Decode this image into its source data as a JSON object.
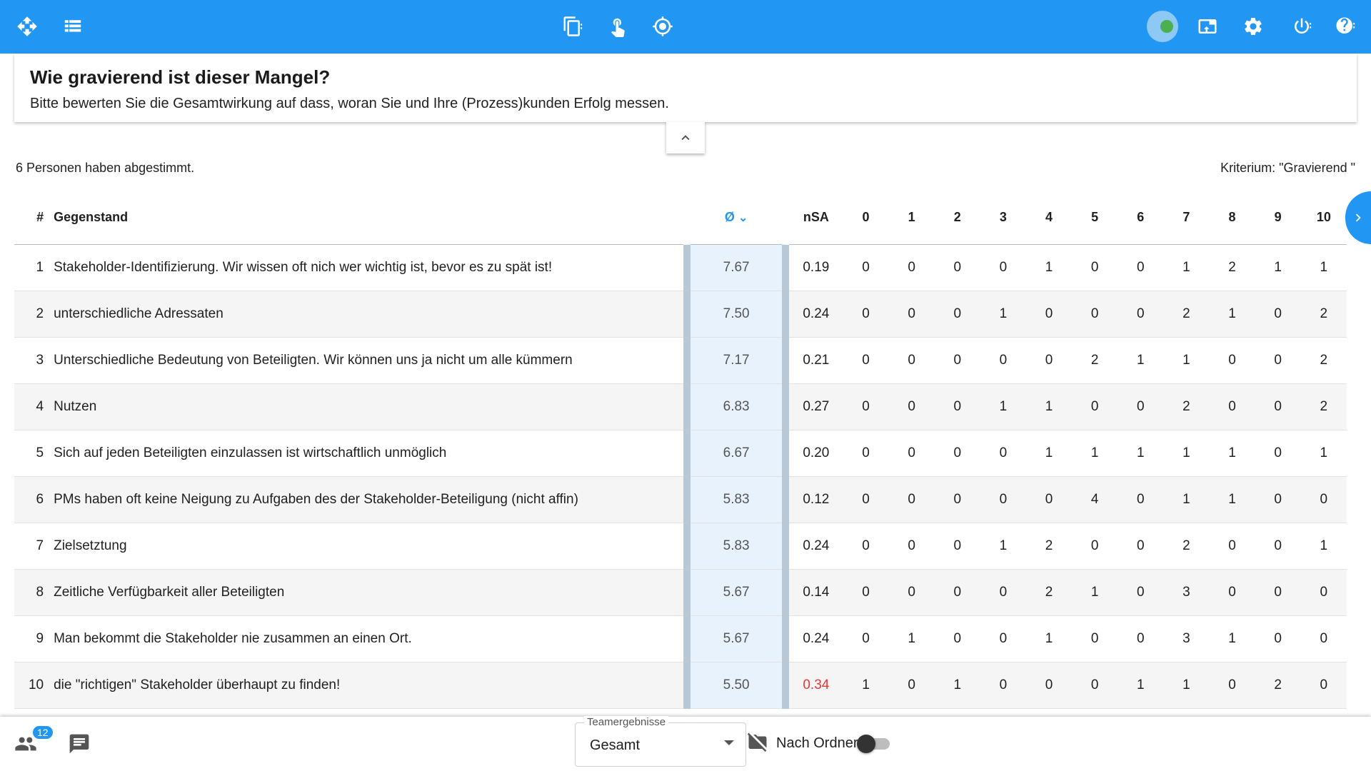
{
  "question": {
    "title": "Wie gravierend ist dieser Mangel?",
    "subtitle": "Bitte bewerten Sie die Gesamtwirkung auf dass, woran Sie und Ihre (Prozess)kunden Erfolg messen."
  },
  "summary": {
    "votes_text": "6 Personen haben abgestimmt.",
    "criterion_text": "Kriterium: \"Gravierend \""
  },
  "table": {
    "headers": {
      "index": "#",
      "item": "Gegenstand",
      "avg": "Ø",
      "nsa": "nSA",
      "scale": [
        "0",
        "1",
        "2",
        "3",
        "4",
        "5",
        "6",
        "7",
        "8",
        "9",
        "10"
      ]
    },
    "rows": [
      {
        "index": "1",
        "item": "Stakeholder-Identifizierung. Wir wissen oft nich wer wichtig ist, bevor es zu spät ist!",
        "avg": "7.67",
        "nsa": "0.19",
        "counts": [
          "0",
          "0",
          "0",
          "0",
          "1",
          "0",
          "0",
          "1",
          "2",
          "1",
          "1"
        ]
      },
      {
        "index": "2",
        "item": "unterschiedliche Adressaten",
        "avg": "7.50",
        "nsa": "0.24",
        "counts": [
          "0",
          "0",
          "0",
          "1",
          "0",
          "0",
          "0",
          "2",
          "1",
          "0",
          "2"
        ]
      },
      {
        "index": "3",
        "item": "Unterschiedliche Bedeutung von Beteiligten. Wir können uns ja nicht um alle kümmern",
        "avg": "7.17",
        "nsa": "0.21",
        "counts": [
          "0",
          "0",
          "0",
          "0",
          "0",
          "2",
          "1",
          "1",
          "0",
          "0",
          "2"
        ]
      },
      {
        "index": "4",
        "item": "Nutzen",
        "avg": "6.83",
        "nsa": "0.27",
        "counts": [
          "0",
          "0",
          "0",
          "1",
          "1",
          "0",
          "0",
          "2",
          "0",
          "0",
          "2"
        ]
      },
      {
        "index": "5",
        "item": "Sich auf jeden Beteiligten einzulassen ist wirtschaftlich unmöglich",
        "avg": "6.67",
        "nsa": "0.20",
        "counts": [
          "0",
          "0",
          "0",
          "0",
          "1",
          "1",
          "1",
          "1",
          "1",
          "0",
          "1"
        ]
      },
      {
        "index": "6",
        "item": "PMs haben oft keine Neigung zu Aufgaben des der Stakeholder-Beteiligung (nicht affin)",
        "avg": "5.83",
        "nsa": "0.12",
        "counts": [
          "0",
          "0",
          "0",
          "0",
          "0",
          "4",
          "0",
          "1",
          "1",
          "0",
          "0"
        ]
      },
      {
        "index": "7",
        "item": "Zielsetztung",
        "avg": "5.83",
        "nsa": "0.24",
        "counts": [
          "0",
          "0",
          "0",
          "1",
          "2",
          "0",
          "0",
          "2",
          "0",
          "0",
          "1"
        ]
      },
      {
        "index": "8",
        "item": "Zeitliche Verfügbarkeit aller Beteiligten",
        "avg": "5.67",
        "nsa": "0.14",
        "counts": [
          "0",
          "0",
          "0",
          "0",
          "2",
          "1",
          "0",
          "3",
          "0",
          "0",
          "0"
        ]
      },
      {
        "index": "9",
        "item": "Man bekommt die Stakeholder nie zusammen an einen Ort.",
        "avg": "5.67",
        "nsa": "0.24",
        "counts": [
          "0",
          "1",
          "0",
          "0",
          "1",
          "0",
          "0",
          "3",
          "1",
          "0",
          "0"
        ]
      },
      {
        "index": "10",
        "item": "die \"richtigen\" Stakeholder überhaupt zu finden!",
        "avg": "5.50",
        "nsa": "0.34",
        "nsa_highlight": true,
        "counts": [
          "1",
          "0",
          "1",
          "0",
          "0",
          "0",
          "1",
          "1",
          "0",
          "2",
          "0"
        ]
      }
    ]
  },
  "bottom": {
    "participants_badge": "12",
    "select_label": "Teamergebnisse",
    "select_value": "Gesamt",
    "toggle_label": "Nach Ordner",
    "toggle_on": false
  },
  "icons": {
    "topbar_left": [
      "move-arrows-icon",
      "list-icon"
    ],
    "topbar_center": [
      "copy-icon",
      "pointer-hand-icon",
      "target-icon"
    ],
    "topbar_right": [
      "connection-status-icon",
      "export-icon",
      "settings-icon",
      "power-icon",
      "help-icon"
    ]
  },
  "colors": {
    "primary": "#2196f3",
    "avg_column_bg": "#e8f2fc",
    "highlight_red": "#e53935",
    "status_green": "#4caf50"
  }
}
